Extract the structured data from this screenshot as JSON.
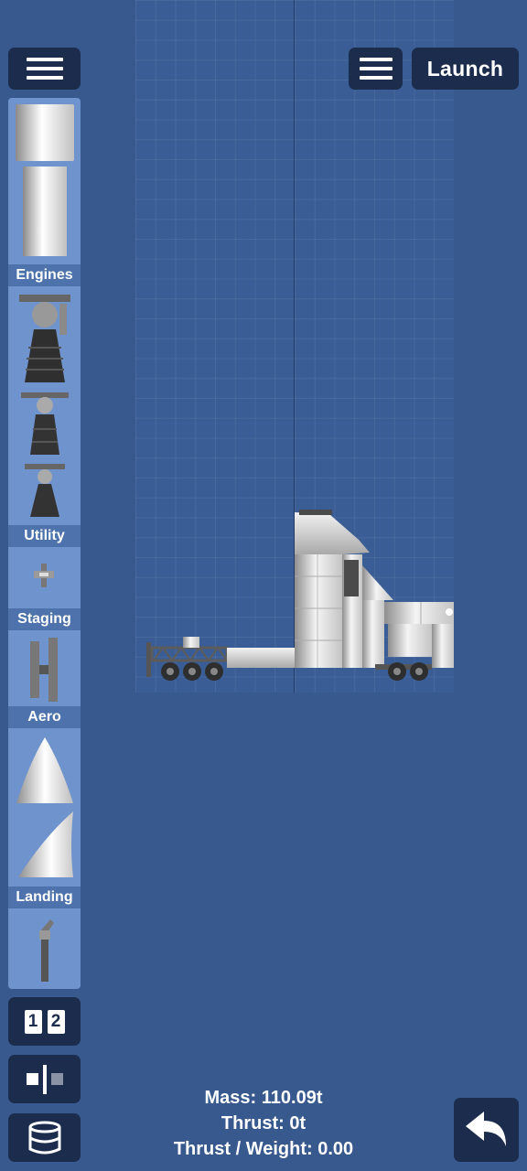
{
  "toolbar": {
    "menu_icon": "hamburger-menu-icon",
    "launch_label": "Launch"
  },
  "palette": {
    "categories": [
      "Engines",
      "Utility",
      "Staging",
      "Aero",
      "Landing"
    ]
  },
  "bottom_tools": {
    "stage_numbers": [
      "1",
      "2"
    ],
    "symmetry_icon": "symmetry-icon",
    "part_icon": "fuel-tank-icon",
    "undo_icon": "undo-arrow-icon"
  },
  "stats": {
    "mass": "Mass: 110.09t",
    "thrust": "Thrust: 0t",
    "thrust_weight": "Thrust / Weight: 0.00"
  },
  "colors": {
    "background": "#38598e",
    "grid": "#3a5d95",
    "palette": "#6f93cc",
    "category_label": "#4e72ab",
    "button": "#1b2c4c"
  }
}
